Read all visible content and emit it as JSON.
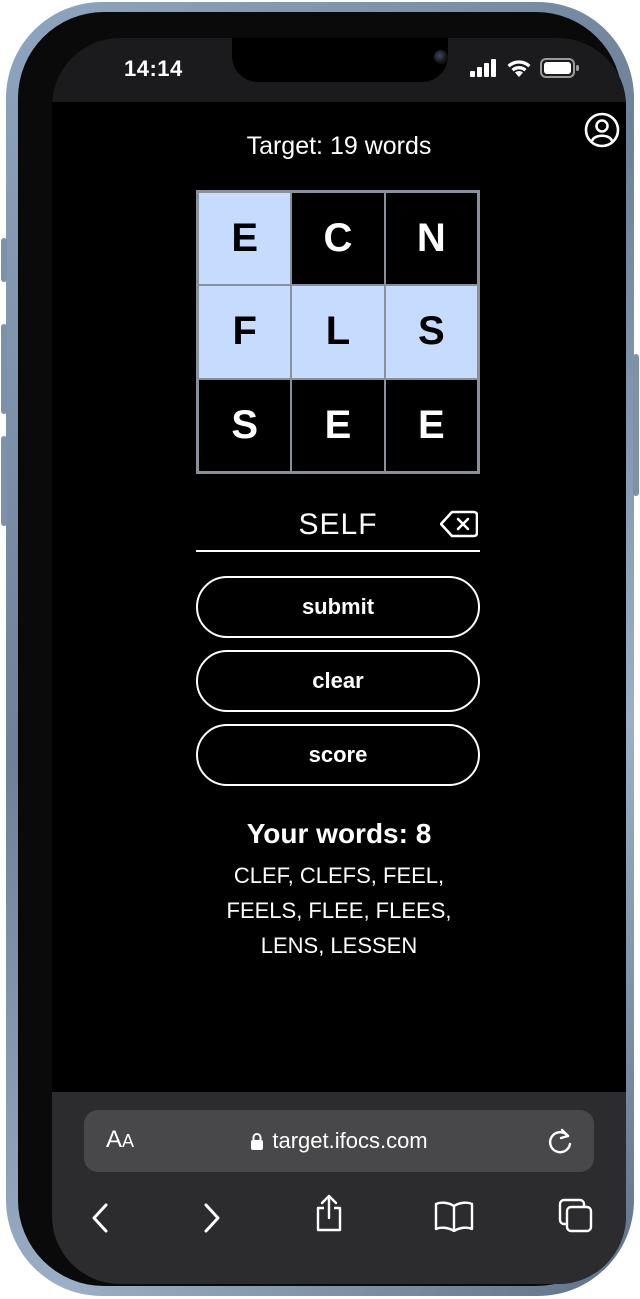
{
  "status_bar": {
    "time": "14:14",
    "icons": [
      "cellular-signal-icon",
      "wifi-icon",
      "battery-icon"
    ]
  },
  "game": {
    "target_text": "Target: 19 words",
    "grid": [
      {
        "letter": "E",
        "selected": true
      },
      {
        "letter": "C",
        "selected": false
      },
      {
        "letter": "N",
        "selected": false
      },
      {
        "letter": "F",
        "selected": true
      },
      {
        "letter": "L",
        "selected": true
      },
      {
        "letter": "S",
        "selected": true
      },
      {
        "letter": "S",
        "selected": false
      },
      {
        "letter": "E",
        "selected": false
      },
      {
        "letter": "E",
        "selected": false
      }
    ],
    "current_word": "SELF",
    "buttons": {
      "submit": "submit",
      "clear": "clear",
      "score": "score"
    },
    "your_words_title": "Your words: 8",
    "your_words_list": "CLEF, CLEFS, FEEL, FEELS, FLEE, FLEES, LENS, LESSEN",
    "colors": {
      "selected_cell": "#c5dcff",
      "cell_border": "#8a909a",
      "background": "#000000"
    }
  },
  "browser": {
    "text_size_label": "AA",
    "url": "target.ifocs.com",
    "toolbar": [
      "back-icon",
      "forward-icon",
      "share-icon",
      "bookmarks-icon",
      "tabs-icon"
    ]
  }
}
